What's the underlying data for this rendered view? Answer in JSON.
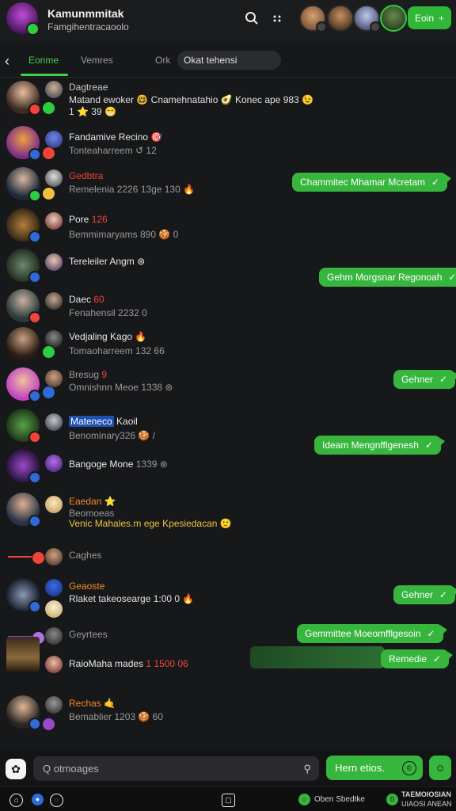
{
  "header": {
    "title": "Kamunmmitak",
    "subtitle": "Famgihentracaoolo",
    "search_icon": "search-icon",
    "more_icon": "more-icon",
    "new_chat_label": "Eoin",
    "new_chat_icon": "+"
  },
  "tabs": {
    "back_icon": "‹",
    "items": [
      "Eonme",
      "Vemres",
      "Ork"
    ],
    "search_value": "Okat tehensi"
  },
  "chats": [
    {
      "name": "Dagtreae",
      "line2": "Matand ewoker 🤓 Cnamehnatahio 🥑 Koneс ape 983 😉",
      "line3": "1 ⭐ 39 😁"
    },
    {
      "name": "Fandamive Recino",
      "name_emoji": "🎯",
      "preview": "Tonteaharreem  ↺ 12"
    },
    {
      "name": "Gedbtra",
      "preview": "Remelenia 2226  13ge  130 🔥"
    },
    {
      "name": "Pore",
      "name_tag": "126",
      "preview": "Bemmimaryams  890  🍪  0"
    },
    {
      "name": "Tereleiler Angm",
      "name_emoji": "⊛",
      "preview": ""
    },
    {
      "name": "Daec",
      "name_tag": "60",
      "preview": "Fenahensil 2232  0"
    },
    {
      "name": "Vedjaling Kago",
      "name_emoji": "🔥",
      "preview": "Tomaoharreem  132 66"
    },
    {
      "name": "Bresug",
      "name_tag": "9",
      "preview": "Omnishnn Meoe  1338  ⊛"
    },
    {
      "name": "Mateneco",
      "name_rest": "Kaoil",
      "preview": "Benominary326  🍪  /"
    },
    {
      "name": "Bangoge Mone",
      "name_tag2": "1339 ⊛",
      "preview": ""
    },
    {
      "name": "Eaedan",
      "name_emoji": "⭐",
      "preview": "Beomoeas",
      "line3": "Venic Mahales.m  ege  Kpesiedacan 🙂"
    },
    {
      "name": "",
      "preview": "Caghes"
    },
    {
      "name": "Geaoste",
      "preview": "Rlaket takeosearge 1:00 0 🔥"
    },
    {
      "name": "",
      "preview": "Geyrtees"
    },
    {
      "name": "RaioMaha mades",
      "name_tag": "1 1500 06",
      "preview": ""
    },
    {
      "name": "Rechas",
      "name_emoji": "🤙",
      "preview": "Bemablier 1203  🍪  60"
    }
  ],
  "bubbles": [
    {
      "text": "Chammitec Mhamar Mcretam",
      "check": "✓"
    },
    {
      "text": "Gehm Morgsnar Regonoah",
      "check": "✓"
    },
    {
      "text": "Gehner",
      "check": "✓"
    },
    {
      "text": "Ideam Mengnfflgenesh",
      "check": "✓"
    },
    {
      "text": "Gehner",
      "check": "✓"
    },
    {
      "text": "Gemmittee Moeomfflgesoin",
      "check": "✓"
    },
    {
      "text": "Remedie",
      "check": "✓"
    }
  ],
  "composer": {
    "left_icon": "✿",
    "placeholder": "Q  otmoages",
    "mic_icon": "⚲",
    "send_label": "Hern etios.",
    "send_icon": "©",
    "emoji_icon": "☺"
  },
  "bottom_bar": {
    "status_text": "Oben Sbedtke",
    "right_text_1": "TAEMOIOSIAN",
    "right_text_2": "UIAOSI ANEAN"
  },
  "colors": {
    "accent": "#37b63e",
    "background": "#17181a",
    "badge_red": "#f2433a",
    "badge_blue": "#2e6ad8"
  }
}
